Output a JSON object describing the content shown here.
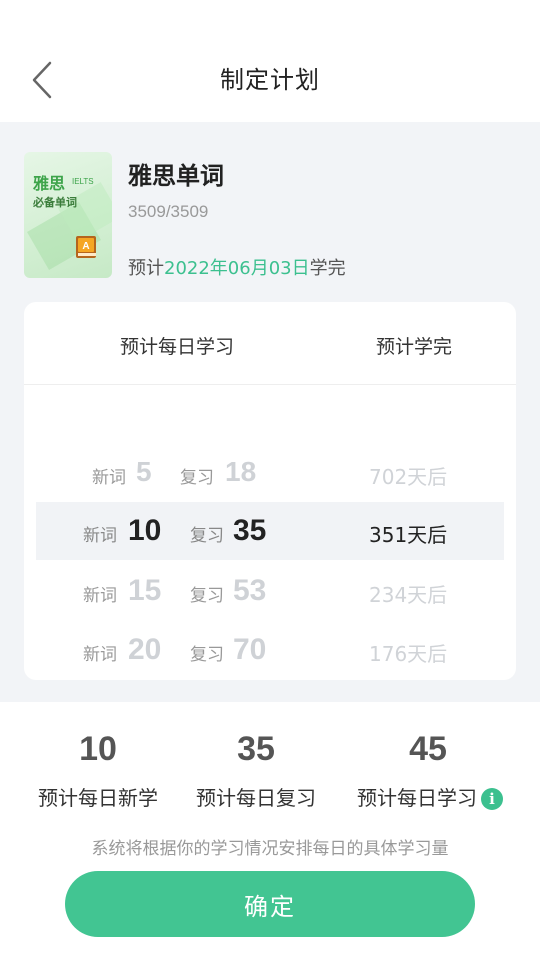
{
  "header": {
    "title": "制定计划"
  },
  "book": {
    "cover_title": "雅思",
    "cover_tag": "IELTS",
    "cover_subtitle": "必备单词",
    "name": "雅思单词",
    "progress": "3509/3509",
    "estimate_prefix": "预计",
    "estimate_date": "2022年06月03日",
    "estimate_suffix": "学完",
    "accent_color": "#3cc08f"
  },
  "plan": {
    "col_daily": "预计每日学习",
    "col_finish": "预计学完",
    "new_label": "新词",
    "review_label": "复习",
    "rows": [
      {
        "new": "5",
        "review": "18",
        "finish": "702天后",
        "selected": false
      },
      {
        "new": "10",
        "review": "35",
        "finish": "351天后",
        "selected": true
      },
      {
        "new": "15",
        "review": "53",
        "finish": "234天后",
        "selected": false
      },
      {
        "new": "20",
        "review": "70",
        "finish": "176天后",
        "selected": false
      }
    ]
  },
  "summary": {
    "daily_new": {
      "value": "10",
      "label": "预计每日新学"
    },
    "daily_review": {
      "value": "35",
      "label": "预计每日复习"
    },
    "daily_total": {
      "value": "45",
      "label": "预计每日学习"
    },
    "info_icon": "info-icon",
    "hint": "系统将根据你的学习情况安排每日的具体学习量",
    "confirm_label": "确定",
    "button_color": "#42c592"
  }
}
